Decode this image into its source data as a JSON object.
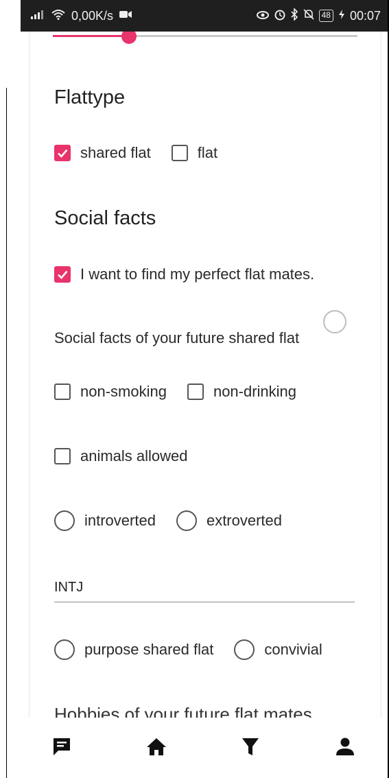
{
  "status_bar": {
    "speed": "0,00K/s",
    "battery": "48",
    "time": "00:07"
  },
  "slider": {
    "value_fraction": 0.25,
    "accent": "#e8336b"
  },
  "flattype": {
    "title": "Flattype",
    "options": [
      {
        "label": "shared flat",
        "checked": true
      },
      {
        "label": "flat",
        "checked": false
      }
    ]
  },
  "social": {
    "title": "Social facts",
    "find_mates": {
      "label": "I want to find my perfect flat mates.",
      "checked": true
    },
    "subtitle": "Social facts of your future shared flat",
    "checkboxes": [
      {
        "label": "non-smoking",
        "checked": false
      },
      {
        "label": "non-drinking",
        "checked": false
      },
      {
        "label": "animals allowed",
        "checked": false
      }
    ],
    "personality": [
      {
        "label": "introverted"
      },
      {
        "label": "extroverted"
      }
    ],
    "mbti_value": "INTJ",
    "flat_type": [
      {
        "label": "purpose shared flat"
      },
      {
        "label": "convivial"
      }
    ]
  },
  "hobbies_heading": "Hobbies of your future flat mates",
  "nav": {
    "items": [
      "chat-icon",
      "home-icon",
      "filter-icon",
      "person-icon"
    ]
  }
}
